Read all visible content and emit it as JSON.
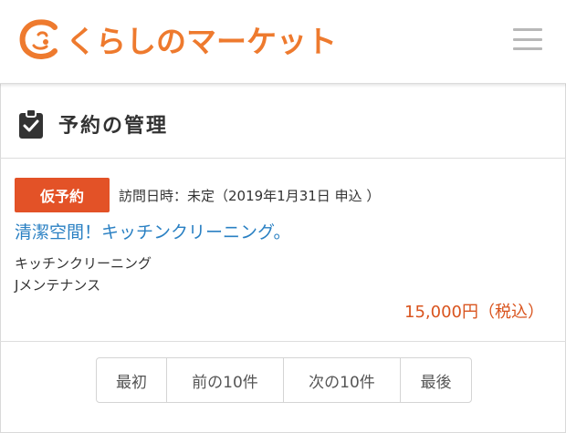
{
  "header": {
    "logo_text": "くらしのマーケット",
    "brand_color": "#ee7a2e",
    "menu_icon": "hamburger-menu-icon"
  },
  "page": {
    "title": "予約の管理",
    "title_icon": "clipboard-check-icon"
  },
  "reservations": [
    {
      "status": "仮予約",
      "status_color": "#e35227",
      "visit": "訪問日時：未定（2019年1月31日 申込 ）",
      "title": "清潔空間！キッチンクリーニング。",
      "service": "キッチンクリーニング",
      "vendor": "Jメンテナンス",
      "price": "15,000円（税込）"
    }
  ],
  "pagination": {
    "first": "最初",
    "prev": "前の10件",
    "next": "次の10件",
    "last": "最後"
  }
}
